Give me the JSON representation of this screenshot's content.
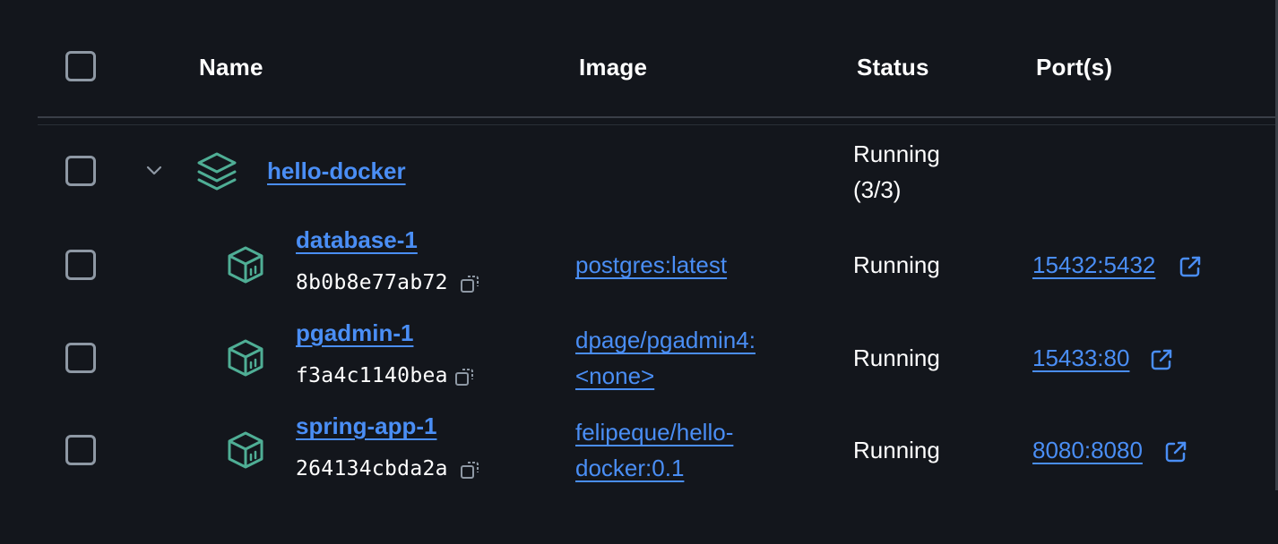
{
  "header": {
    "name": "Name",
    "image": "Image",
    "status": "Status",
    "ports": "Port(s)"
  },
  "group": {
    "name": "hello-docker",
    "status_line1": "Running",
    "status_line2": "(3/3)",
    "icon": "layers-stack-icon",
    "expand_icon": "chevron-down-icon"
  },
  "containers": [
    {
      "name": "database-1",
      "id": "8b0b8e77ab72",
      "image_line1": "postgres:latest",
      "image_line2": "",
      "status": "Running",
      "port": "15432:5432"
    },
    {
      "name": "pgadmin-1",
      "id": "f3a4c1140bea",
      "image_line1": "dpage/pgadmin4:",
      "image_line2": "<none>",
      "status": "Running",
      "port": "15433:80"
    },
    {
      "name": "spring-app-1",
      "id": "264134cbda2a",
      "image_line1": "felipeque/hello-",
      "image_line2": "docker:0.1",
      "status": "Running",
      "port": "8080:8080"
    }
  ],
  "colors": {
    "background": "#13161c",
    "link": "#4a8ef5",
    "icon_green": "#4fae95",
    "checkbox_border": "#8e98a4"
  }
}
